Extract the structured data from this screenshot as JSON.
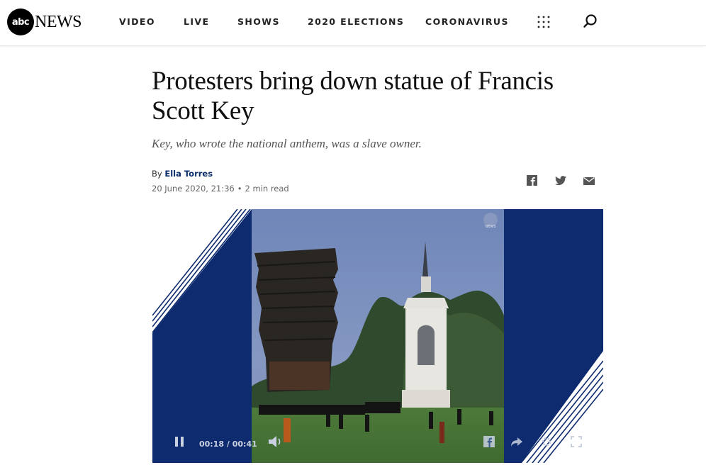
{
  "brand": {
    "logo_circle": "abc",
    "logo_word": "NEWS"
  },
  "nav": {
    "items": [
      "VIDEO",
      "LIVE",
      "SHOWS",
      "2020 ELECTIONS",
      "CORONAVIRUS"
    ],
    "more_icon": "grid-dots-icon",
    "search_icon": "search-icon"
  },
  "article": {
    "headline": "Protesters bring down statue of Francis Scott Key",
    "subhead": "Key, who wrote the national anthem, was a slave owner.",
    "by_prefix": "By",
    "author": "Ella Torres",
    "date": "20 June 2020, 21:36",
    "read_time": "2 min read",
    "share": [
      "facebook-icon",
      "twitter-icon",
      "email-icon"
    ]
  },
  "video": {
    "watermark": "NEWS",
    "current_time": "00:18",
    "separator": "/",
    "duration": "00:41",
    "progress": 0.44
  },
  "colors": {
    "accent_navy": "#0d2b6e",
    "author_link": "#0b2d6b",
    "text": "#111111"
  }
}
